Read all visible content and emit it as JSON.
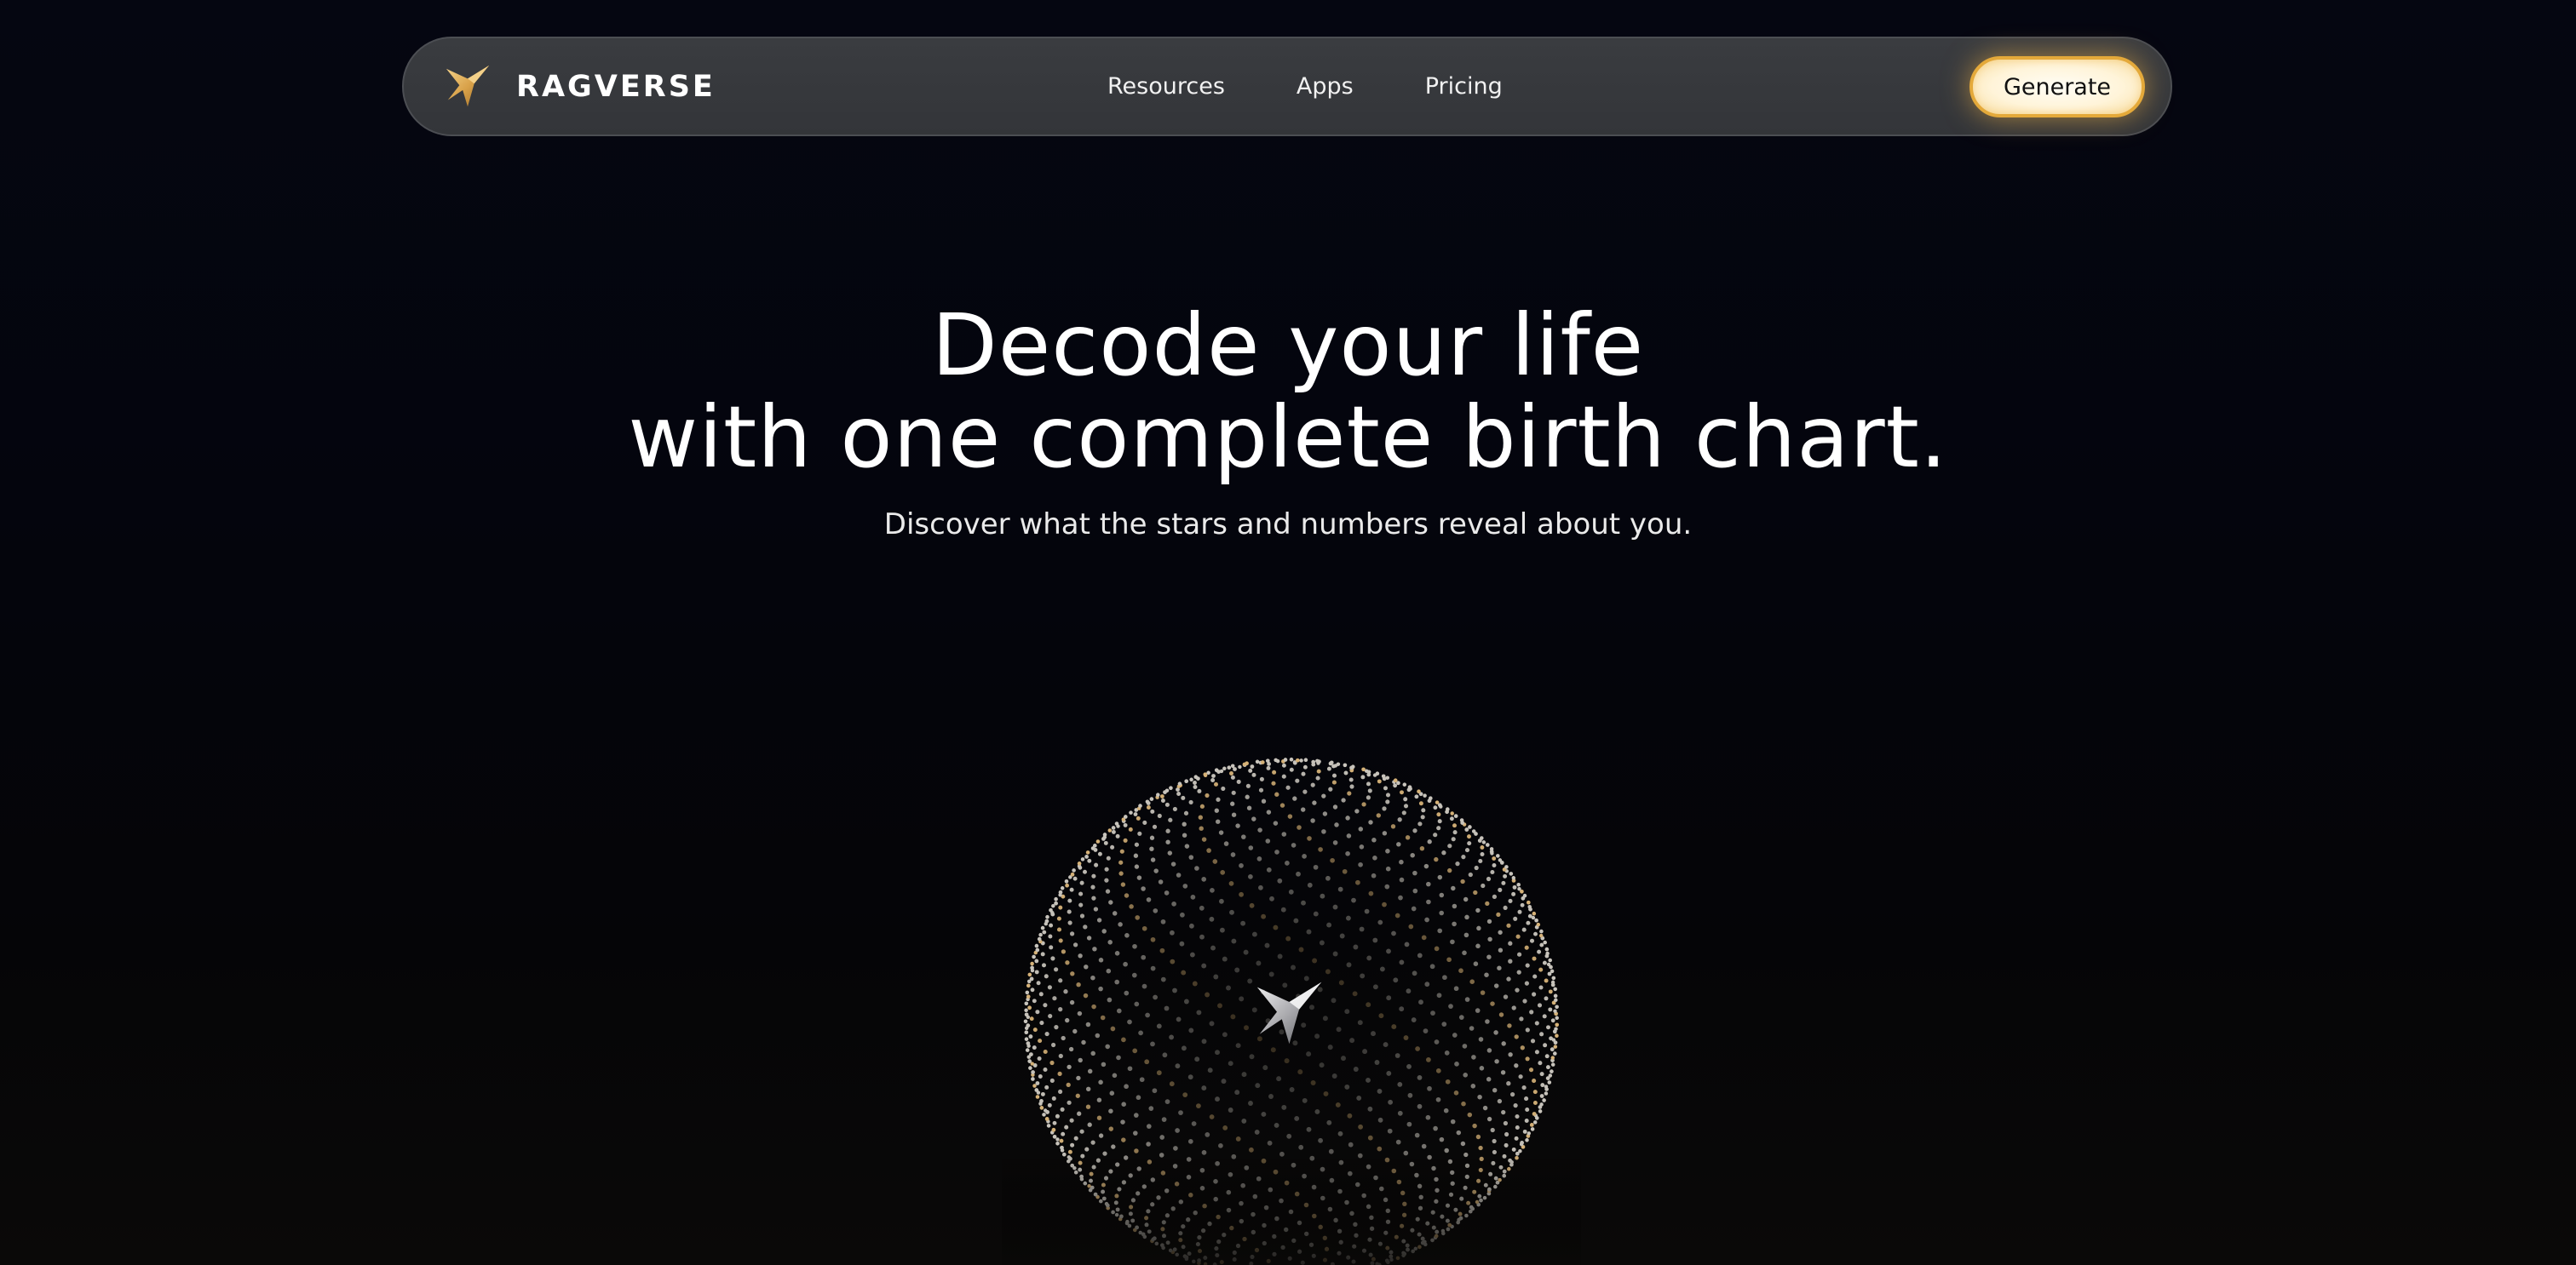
{
  "nav": {
    "brand_name": "RAGVERSE",
    "brand_icon": "ragverse-logo-icon",
    "links": [
      "Resources",
      "Apps",
      "Pricing"
    ],
    "cta_label": "Generate"
  },
  "hero": {
    "headline_line1": "Decode your life",
    "headline_line2": "with one complete birth chart.",
    "subhead": "Discover what the stars and numbers reveal about you."
  },
  "visual": {
    "sphere_icon": "particle-sphere",
    "center_icon": "ragverse-logo-icon"
  },
  "colors": {
    "background": "#04050d",
    "nav_background": "#36383c",
    "accent_gold": "#e4a93a",
    "button_fill": "#fff4d9",
    "text": "#ffffff"
  }
}
